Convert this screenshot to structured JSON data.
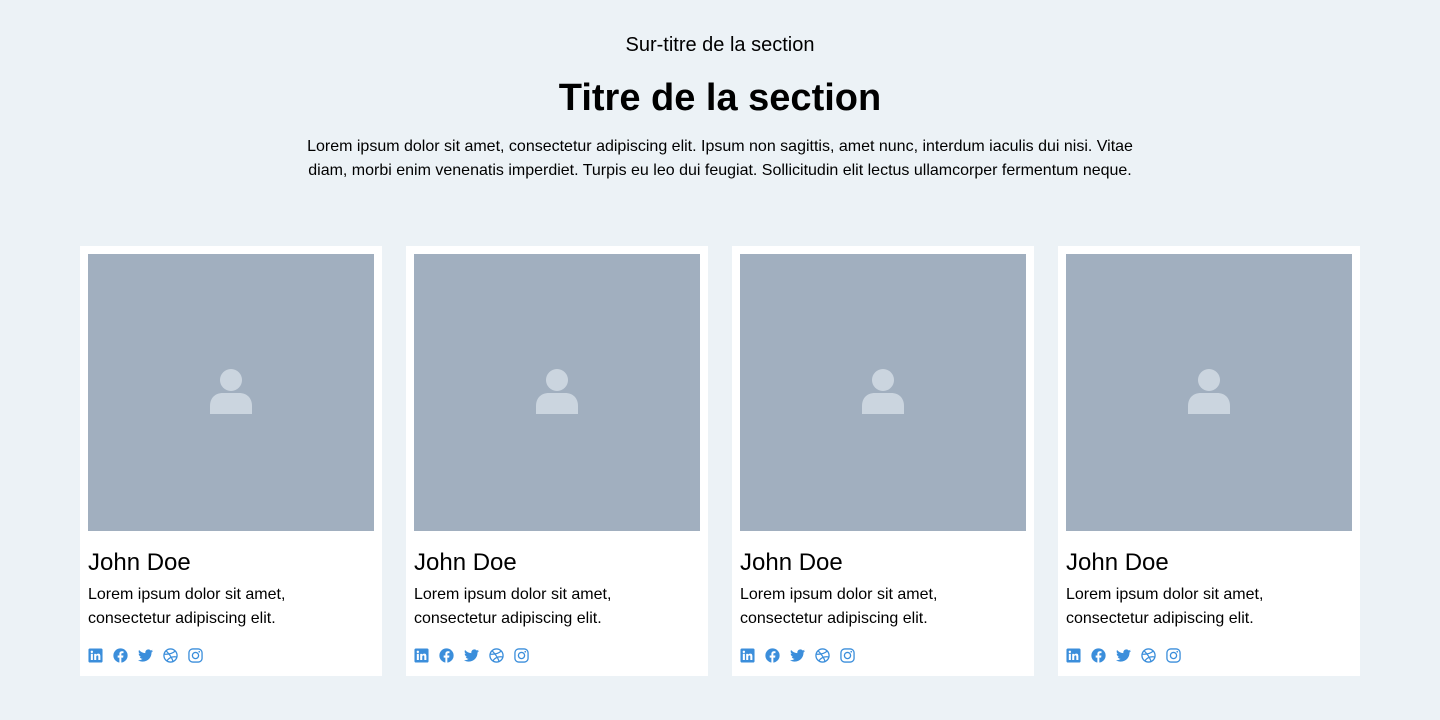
{
  "section": {
    "eyebrow": "Sur-titre de la section",
    "title": "Titre de la section",
    "intro": "Lorem ipsum dolor sit amet, consectetur adipiscing elit. Ipsum non sagittis, amet nunc, interdum iaculis dui nisi. Vitae diam, morbi enim venenatis imperdiet. Turpis eu leo dui feugiat. Sollicitudin elit lectus ullamcorper fermentum neque."
  },
  "colors": {
    "background": "#ECF2F6",
    "card": "#FFFFFF",
    "photo_placeholder": "#A1AFBF",
    "avatar_icon": "#CBD5DF",
    "social_icon": "#3B8EDB"
  },
  "team": [
    {
      "name": "John Doe",
      "description": "Lorem ipsum dolor sit amet, consectetur adipiscing elit.",
      "photo_icon": "user-placeholder-icon",
      "socials": [
        "linkedin-icon",
        "facebook-icon",
        "twitter-icon",
        "dribbble-icon",
        "instagram-icon"
      ]
    },
    {
      "name": "John Doe",
      "description": "Lorem ipsum dolor sit amet, consectetur adipiscing elit.",
      "photo_icon": "user-placeholder-icon",
      "socials": [
        "linkedin-icon",
        "facebook-icon",
        "twitter-icon",
        "dribbble-icon",
        "instagram-icon"
      ]
    },
    {
      "name": "John Doe",
      "description": "Lorem ipsum dolor sit amet, consectetur adipiscing elit.",
      "photo_icon": "user-placeholder-icon",
      "socials": [
        "linkedin-icon",
        "facebook-icon",
        "twitter-icon",
        "dribbble-icon",
        "instagram-icon"
      ]
    },
    {
      "name": "John Doe",
      "description": "Lorem ipsum dolor sit amet, consectetur adipiscing elit.",
      "photo_icon": "user-placeholder-icon",
      "socials": [
        "linkedin-icon",
        "facebook-icon",
        "twitter-icon",
        "dribbble-icon",
        "instagram-icon"
      ]
    }
  ]
}
